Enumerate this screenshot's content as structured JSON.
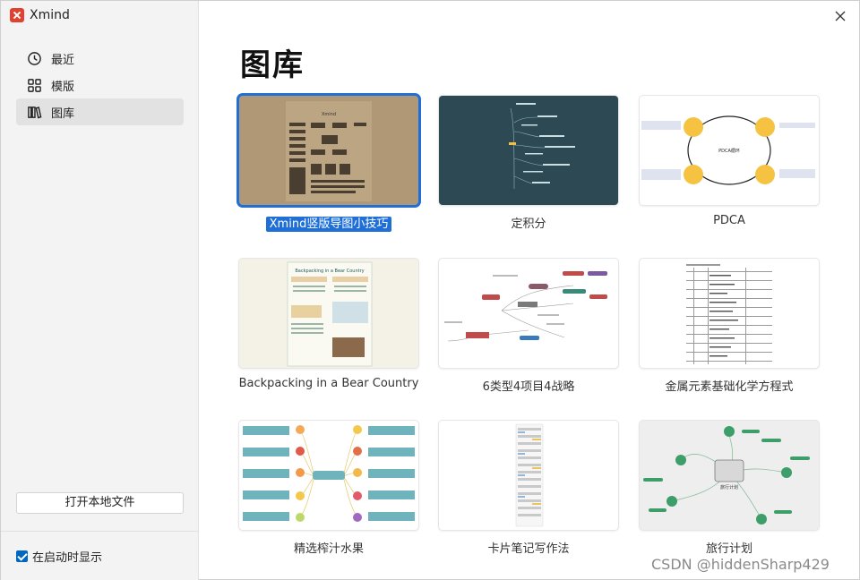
{
  "app": {
    "title": "Xmind"
  },
  "sidebar": {
    "items": [
      {
        "label": "最近",
        "icon": "clock-icon"
      },
      {
        "label": "模版",
        "icon": "grid-icon"
      },
      {
        "label": "图库",
        "icon": "library-icon",
        "active": true
      }
    ],
    "open_local_label": "打开本地文件",
    "startup_label": "在启动时显示",
    "startup_checked": true
  },
  "main": {
    "title": "图库",
    "gallery": [
      {
        "label": "Xmind竖版导图小技巧",
        "selected": true,
        "thumb": "Xmind"
      },
      {
        "label": "定积分"
      },
      {
        "label": "PDCA",
        "thumb": "PDCA循环"
      },
      {
        "label": "Backpacking in a Bear Country",
        "thumb": "Backpacking in a Bear Country"
      },
      {
        "label": "6类型4项目4战略"
      },
      {
        "label": "金属元素基础化学方程式"
      },
      {
        "label": "精选榨汁水果"
      },
      {
        "label": "卡片笔记写作法"
      },
      {
        "label": "旅行计划",
        "thumb": "旅行计划"
      }
    ]
  },
  "watermark": "CSDN @hiddenSharp429",
  "colors": {
    "accent": "#1f6fd6",
    "brand": "#e0422f",
    "pdca_node": "#f5c242",
    "teal_dark": "#2d4a54",
    "travel_green": "#3e9e6a"
  }
}
